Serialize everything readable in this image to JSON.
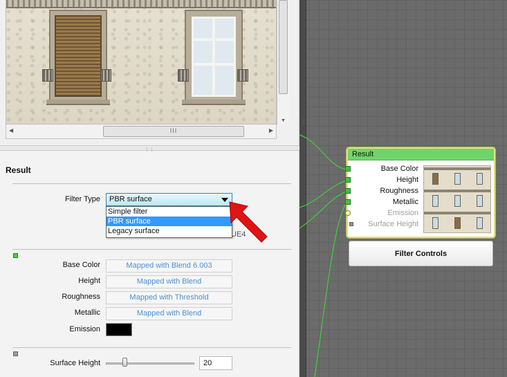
{
  "panel": {
    "title": "Result",
    "filter_type_label": "Filter Type",
    "filter_type_value": "PBR surface",
    "filter_options": [
      "Simple filter",
      "PBR surface",
      "Legacy surface"
    ],
    "selected_option_index": 1,
    "hidden_text_fragment": "UE4",
    "channels": [
      {
        "label": "Base Color",
        "value": "Mapped with Blend 6.003"
      },
      {
        "label": "Height",
        "value": "Mapped with Blend"
      },
      {
        "label": "Roughness",
        "value": "Mapped with Threshold"
      },
      {
        "label": "Metallic",
        "value": "Mapped with Blend"
      }
    ],
    "emission_label": "Emission",
    "emission_color": "#000000",
    "surface_height_label": "Surface Height",
    "surface_height_value": "20",
    "accent_selection": "#3399ff",
    "link_text_color": "#4a8fd6"
  },
  "scroll": {
    "grip_glyph": "III"
  },
  "node": {
    "title": "Result",
    "header_color": "#6fd56a",
    "ports": [
      {
        "label": "Base Color",
        "state": "connected"
      },
      {
        "label": "Height",
        "state": "connected"
      },
      {
        "label": "Roughness",
        "state": "connected"
      },
      {
        "label": "Metallic",
        "state": "connected"
      },
      {
        "label": "Emission",
        "state": "inactive"
      },
      {
        "label": "Surface Height",
        "state": "disabled"
      }
    ]
  },
  "controls_button": {
    "label": "Filter Controls"
  },
  "annotation": {
    "type": "red-arrow-pointer",
    "color": "#e01414"
  }
}
